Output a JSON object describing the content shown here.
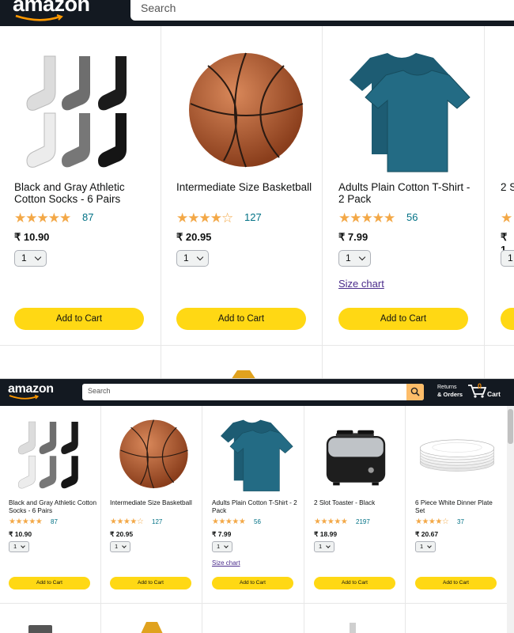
{
  "zoomed_view": {
    "logo": "amazon",
    "search_placeholder": "Search",
    "products": [
      {
        "title": "Black and Gray Athletic Cotton Socks - 6 Pairs",
        "stars": "★★★★★",
        "rating_count": "87",
        "price": "₹ 10.90",
        "qty": "1",
        "button": "Add to Cart",
        "image": "socks"
      },
      {
        "title": "Intermediate Size Basketball",
        "stars": "★★★★☆",
        "rating_count": "127",
        "price": "₹ 20.95",
        "qty": "1",
        "button": "Add to Cart",
        "image": "basketball"
      },
      {
        "title": "Adults Plain Cotton T-Shirt - 2 Pack",
        "stars": "★★★★★",
        "rating_count": "56",
        "price": "₹ 7.99",
        "qty": "1",
        "size_chart": "Size chart",
        "button": "Add to Cart",
        "image": "tshirt"
      },
      {
        "title": "2 S",
        "stars": "★",
        "price": "₹ 1",
        "qty": "1",
        "image": "partial"
      }
    ]
  },
  "full_view": {
    "logo": "amazon",
    "search_placeholder": "Search",
    "returns_line1": "Returns",
    "returns_line2": "& Orders",
    "cart_count": "0",
    "cart_label": "Cart",
    "products": [
      {
        "title": "Black and Gray Athletic Cotton Socks - 6 Pairs",
        "stars": "★★★★★",
        "rating_count": "87",
        "price": "₹ 10.90",
        "qty": "1",
        "button": "Add to Cart",
        "image": "socks"
      },
      {
        "title": "Intermediate Size Basketball",
        "stars": "★★★★☆",
        "rating_count": "127",
        "price": "₹ 20.95",
        "qty": "1",
        "button": "Add to Cart",
        "image": "basketball"
      },
      {
        "title": "Adults Plain Cotton T-Shirt - 2 Pack",
        "stars": "★★★★★",
        "rating_count": "56",
        "price": "₹ 7.99",
        "qty": "1",
        "size_chart": "Size chart",
        "button": "Add to Cart",
        "image": "tshirt"
      },
      {
        "title": "2 Slot Toaster - Black",
        "stars": "★★★★★",
        "rating_count": "2197",
        "price": "₹ 18.99",
        "qty": "1",
        "button": "Add to Cart",
        "image": "toaster"
      },
      {
        "title": "6 Piece White Dinner Plate Set",
        "stars": "★★★★☆",
        "rating_count": "37",
        "price": "₹ 20.67",
        "qty": "1",
        "button": "Add to Cart",
        "image": "plates"
      }
    ]
  },
  "colors": {
    "header": "#131921",
    "button": "#ffd814",
    "star": "#f3a847",
    "link": "#007185",
    "search_button": "#febd69"
  }
}
